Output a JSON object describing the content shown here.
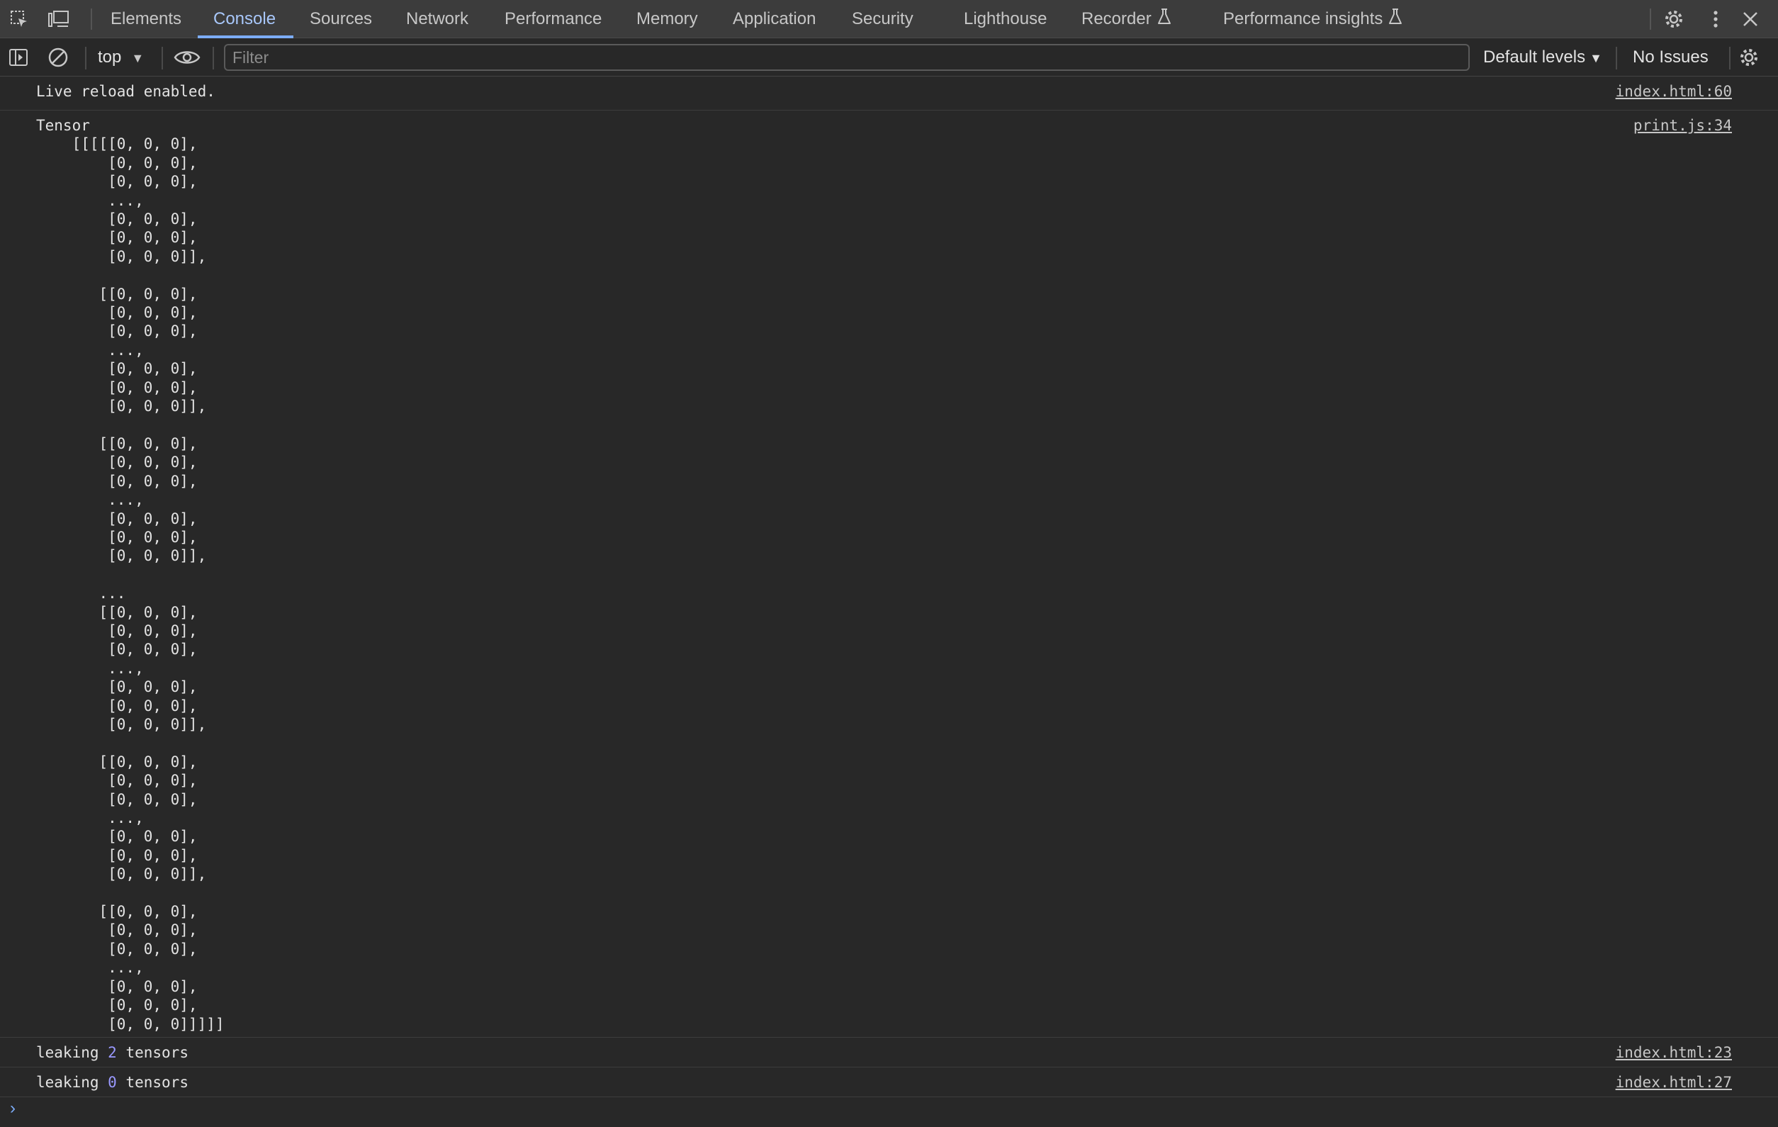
{
  "tabs": [
    {
      "label": "Elements",
      "active": false,
      "experimental": false
    },
    {
      "label": "Console",
      "active": true,
      "experimental": false
    },
    {
      "label": "Sources",
      "active": false,
      "experimental": false
    },
    {
      "label": "Network",
      "active": false,
      "experimental": false
    },
    {
      "label": "Performance",
      "active": false,
      "experimental": false
    },
    {
      "label": "Memory",
      "active": false,
      "experimental": false
    },
    {
      "label": "Application",
      "active": false,
      "experimental": false
    },
    {
      "label": "Security",
      "active": false,
      "experimental": false
    },
    {
      "label": "Lighthouse",
      "active": false,
      "experimental": false
    },
    {
      "label": "Recorder",
      "active": false,
      "experimental": true
    },
    {
      "label": "Performance insights",
      "active": false,
      "experimental": true
    }
  ],
  "toolbar": {
    "context": "top",
    "filter_placeholder": "Filter",
    "levels": "Default levels",
    "issues": "No Issues"
  },
  "messages": [
    {
      "text": "Live reload enabled.",
      "source": "index.html:60"
    },
    {
      "text": "Tensor\n    [[[[[0, 0, 0],\n        [0, 0, 0],\n        [0, 0, 0],\n        ...,\n        [0, 0, 0],\n        [0, 0, 0],\n        [0, 0, 0]],\n\n       [[0, 0, 0],\n        [0, 0, 0],\n        [0, 0, 0],\n        ...,\n        [0, 0, 0],\n        [0, 0, 0],\n        [0, 0, 0]],\n\n       [[0, 0, 0],\n        [0, 0, 0],\n        [0, 0, 0],\n        ...,\n        [0, 0, 0],\n        [0, 0, 0],\n        [0, 0, 0]],\n\n       ...\n       [[0, 0, 0],\n        [0, 0, 0],\n        [0, 0, 0],\n        ...,\n        [0, 0, 0],\n        [0, 0, 0],\n        [0, 0, 0]],\n\n       [[0, 0, 0],\n        [0, 0, 0],\n        [0, 0, 0],\n        ...,\n        [0, 0, 0],\n        [0, 0, 0],\n        [0, 0, 0]],\n\n       [[0, 0, 0],\n        [0, 0, 0],\n        [0, 0, 0],\n        ...,\n        [0, 0, 0],\n        [0, 0, 0],\n        [0, 0, 0]]]]]",
      "source": "print.js:34"
    },
    {
      "text_before": "leaking ",
      "count": "2",
      "text_after": " tensors",
      "source": "index.html:23"
    },
    {
      "text_before": "leaking ",
      "count": "0",
      "text_after": " tensors",
      "source": "index.html:27"
    }
  ],
  "prompt": "›",
  "colors": {
    "accent": "#a8c7fa",
    "number": "#9a99ff",
    "background": "#282828",
    "tabbar": "#3c3c3c"
  }
}
